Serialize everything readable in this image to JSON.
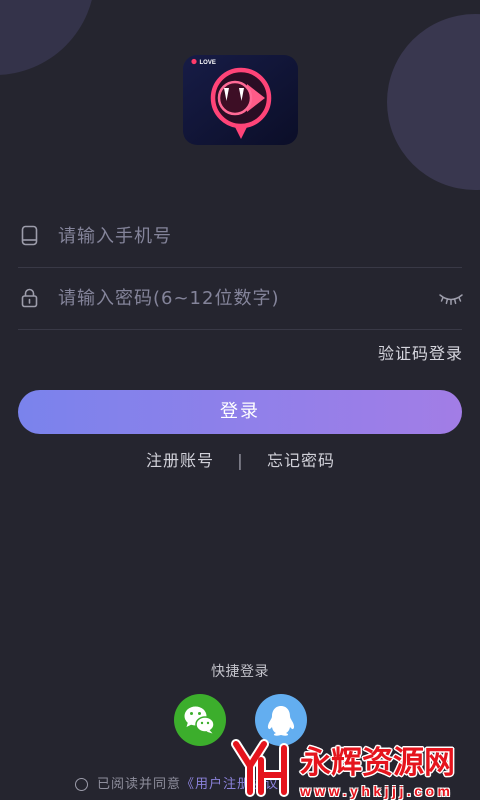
{
  "theme": {
    "background": "#25252f",
    "decor_circle": "#38364d",
    "accent_gradient_start": "#7a83ec",
    "accent_gradient_end": "#a27de6",
    "placeholder_color": "#84849a",
    "agreement_link_color": "#8b82da"
  },
  "logo": {
    "icon": "love-chat-app-logo",
    "badge_text": "LOVE"
  },
  "phone_field": {
    "icon": "phone-icon",
    "placeholder": "请输入手机号",
    "value": ""
  },
  "password_field": {
    "icon": "lock-icon",
    "placeholder": "请输入密码(6~12位数字)",
    "value": "",
    "visibility_toggle_icon": "eye-closed-icon"
  },
  "sms_login": {
    "label": "验证码登录"
  },
  "login_button": {
    "label": "登录"
  },
  "account_links": {
    "register": "注册账号",
    "separator": "|",
    "forgot_password": "忘记密码"
  },
  "quick_login": {
    "title": "快捷登录",
    "providers": [
      {
        "icon": "wechat-icon",
        "color": "#3cae2c"
      },
      {
        "icon": "qq-icon",
        "color": "#63aef0"
      }
    ]
  },
  "agreement": {
    "checked": false,
    "prefix": "已阅读并同意",
    "link": "《用户注册协议》"
  },
  "watermark": {
    "logo_text": "YH",
    "name": "永辉资源网",
    "url": "www.yhkjjj.com",
    "color": "#e5141d"
  }
}
